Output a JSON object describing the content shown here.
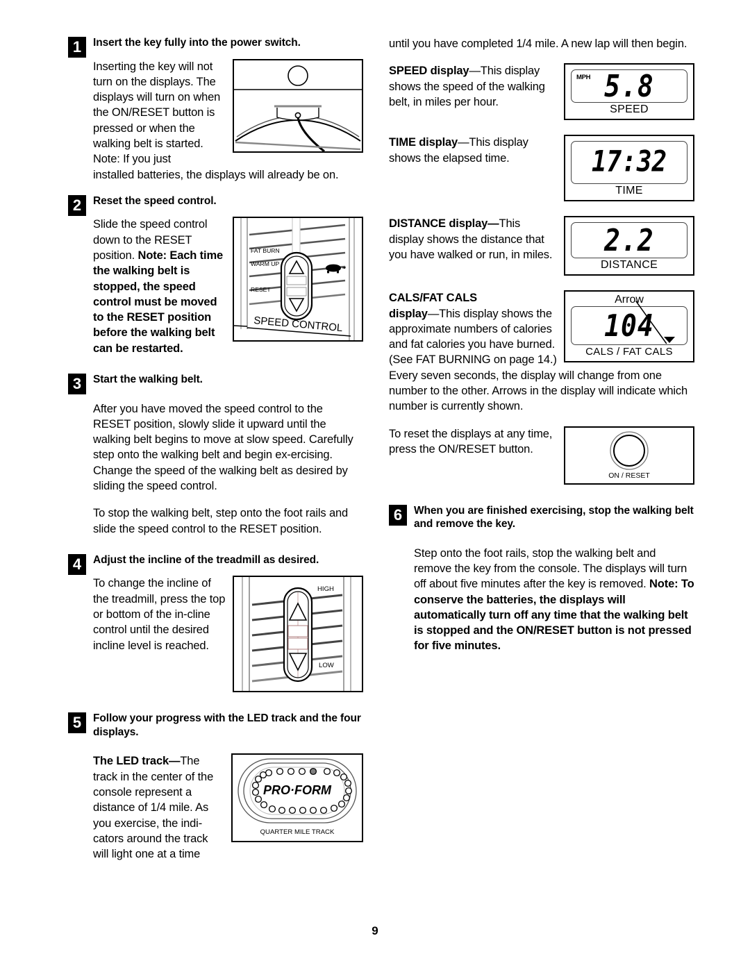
{
  "page": {
    "number": "9"
  },
  "left_column": {
    "step1": {
      "number": "1",
      "title": "Insert the key fully into the power switch.",
      "para_wrap": "Inserting the key will not turn on the displays. The displays will turn on when the ON/RESET button is pressed or when the walking belt is started. Note: If you just",
      "para_full": "installed batteries, the displays will already be on."
    },
    "step2": {
      "number": "2",
      "title": "Reset the speed control.",
      "para_plain": "Slide the speed control down to the RESET position. ",
      "para_bold": "Note: Each time the walking belt is stopped, the speed control must be moved to the RESET position before the walking belt can be restarted."
    },
    "step3": {
      "number": "3",
      "title": "Start the walking belt.",
      "para1": "After you have moved the speed control to the RESET position, slowly slide it upward until the walking belt begins to move at slow speed. Carefully step onto the walking belt and begin ex-ercising. Change the speed of the walking belt as desired by sliding the speed control.",
      "para2": "To stop the walking belt, step onto the foot rails and slide the speed control to the RESET position."
    },
    "step4": {
      "number": "4",
      "title": "Adjust the incline of the treadmill as desired.",
      "para": "To change the incline of the treadmill, press the top or bottom of the in-cline control until the desired incline level is reached."
    },
    "step5": {
      "number": "5",
      "title": "Follow your progress with the LED track and the four displays.",
      "para_bold": "The LED track—",
      "para_rest": "The track in the center of the console represent a distance of 1/4 mile. As you exercise, the indi-cators around the track will light one at a time"
    }
  },
  "right_column": {
    "intro": "until you have completed 1/4 mile. A new lap will then begin.",
    "speed": {
      "label_bold": "SPEED display",
      "label_rest": "—This display shows the speed of the walking belt, in miles per hour."
    },
    "time": {
      "label_bold": "TIME display",
      "label_rest": "—This display shows the elapsed time."
    },
    "distance": {
      "label_bold": "DISTANCE display—",
      "label_rest": "This display shows the distance that you have walked or run, in miles."
    },
    "cals": {
      "label_bold1": "CALS/FAT CALS",
      "label_bold2": "display",
      "label_rest": "—This display shows the approximate numbers of calories and fat calories you have burned. (See FAT BURNING on page 14.)",
      "para_after": "Every seven seconds, the display will change from one number to the other. Arrows in the display will indicate which number is currently shown."
    },
    "reset": {
      "para": "To reset the displays at any time, press the ON/RESET button."
    },
    "step6": {
      "number": "6",
      "title": "When you are finished exercising, stop the walking belt and remove the key.",
      "para_plain": "Step onto the foot rails, stop the walking belt and remove the key from the console. The displays will turn off about five minutes after the key is removed. ",
      "para_bold": "Note: To conserve the batteries, the displays will automatically turn off any time that the walking belt is stopped and the ON/RESET button is not pressed for five minutes."
    }
  },
  "figures": {
    "speed_control": {
      "labels": [
        "FAT BURN",
        "WARM UP",
        "RESET"
      ],
      "caption": "SPEED CONTROL",
      "icon": "turtle-icon"
    },
    "incline_control": {
      "label_high": "HIGH",
      "label_low": "LOW"
    },
    "led_track": {
      "brand": "PRO·FORM",
      "caption": "QUARTER MILE TRACK",
      "led_count": 26,
      "lit_index": 5
    },
    "speed_display": {
      "units": "MPH",
      "value": "5.8",
      "caption": "SPEED"
    },
    "time_display": {
      "value": "17:32",
      "caption": "TIME"
    },
    "distance_display": {
      "value": "2.2",
      "caption": "DISTANCE"
    },
    "cals_display": {
      "arrow_label": "Arrow",
      "value": "104",
      "caption": "CALS / FAT CALS"
    },
    "on_reset": {
      "caption": "ON / RESET"
    }
  }
}
